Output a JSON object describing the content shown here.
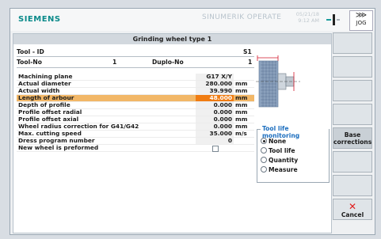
{
  "header": {
    "brand": "SIEMENS",
    "product": "SINUMERIK OPERATE",
    "date": "05/21/18",
    "time": "9:12 AM",
    "mode_label": "JOG"
  },
  "dialog": {
    "title": "Grinding wheel type 1",
    "tool_id_label": "Tool - ID",
    "tool_id_value": "S1",
    "tool_no_label": "Tool-No",
    "tool_no_value": "1",
    "duplo_label": "Duplo-No",
    "duplo_value": "1",
    "params": [
      {
        "label": "Machining plane",
        "value": "G17 X/Y",
        "unit": ""
      },
      {
        "label": "Actual diameter",
        "value": "280.000",
        "unit": "mm"
      },
      {
        "label": "Actual width",
        "value": "39.990",
        "unit": "mm"
      },
      {
        "label": "Length of arbour",
        "value": "48.000",
        "unit": "mm"
      },
      {
        "label": "Depth of profile",
        "value": "0.000",
        "unit": "mm"
      },
      {
        "label": "Profile offset radial",
        "value": "0.000",
        "unit": "mm"
      },
      {
        "label": "Profile offset axial",
        "value": "0.000",
        "unit": "mm"
      },
      {
        "label": "Wheel radius correction for G41/G42",
        "value": "0.000",
        "unit": "mm"
      },
      {
        "label": "Max. cutting speed",
        "value": "35.000",
        "unit": "m/s"
      },
      {
        "label": "Dress program number",
        "value": "0",
        "unit": ""
      },
      {
        "label": "New wheel is preformed",
        "value": "",
        "unit": ""
      }
    ],
    "tool_life": {
      "title": "Tool life monitoring",
      "options": [
        "None",
        "Tool life",
        "Quantity",
        "Measure"
      ],
      "selected": "None"
    }
  },
  "softkeys": {
    "base_corrections": "Base corrections",
    "cancel": "Cancel"
  }
}
